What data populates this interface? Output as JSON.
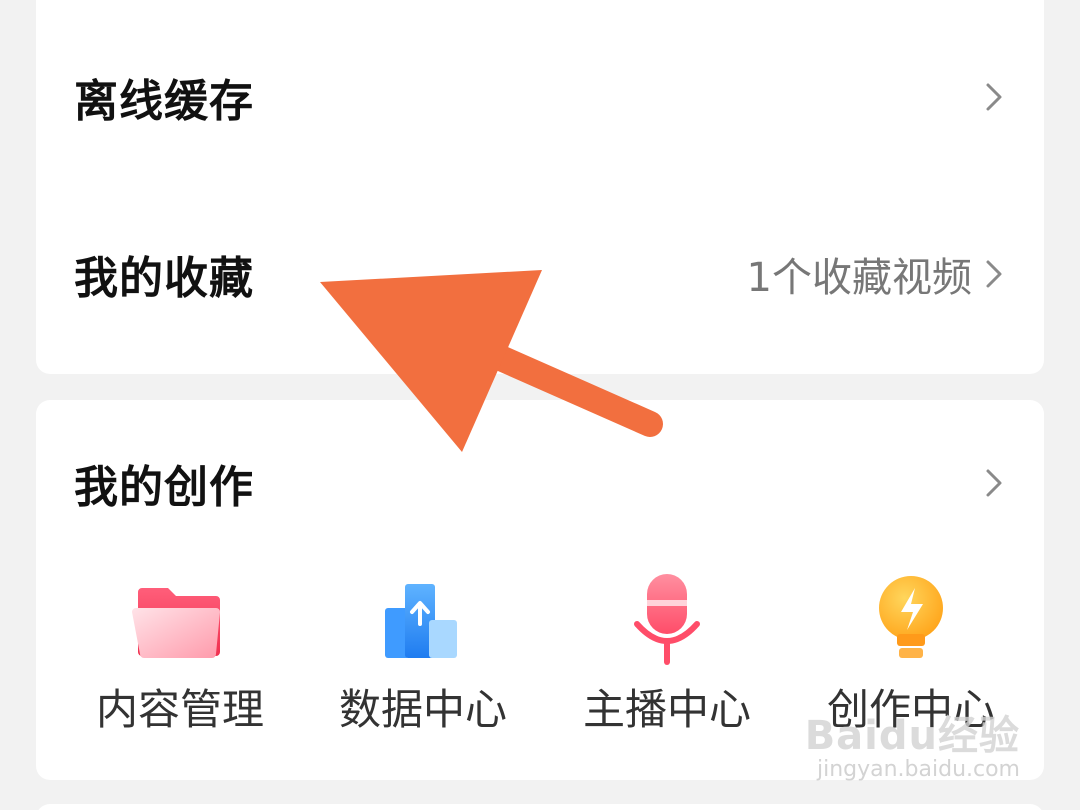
{
  "menu": {
    "offline_cache": {
      "label": "离线缓存"
    },
    "favorites": {
      "label": "我的收藏",
      "sub": "1个收藏视频"
    }
  },
  "creation": {
    "title": "我的创作",
    "tools": [
      {
        "label": "内容管理",
        "icon": "folder-icon"
      },
      {
        "label": "数据中心",
        "icon": "data-chart-icon"
      },
      {
        "label": "主播中心",
        "icon": "microphone-icon"
      },
      {
        "label": "创作中心",
        "icon": "lightbulb-icon"
      }
    ]
  },
  "annotation": {
    "arrow_color": "#f26f3f"
  },
  "watermark": {
    "logo": "Baidu经验",
    "url": "jingyan.baidu.com"
  }
}
